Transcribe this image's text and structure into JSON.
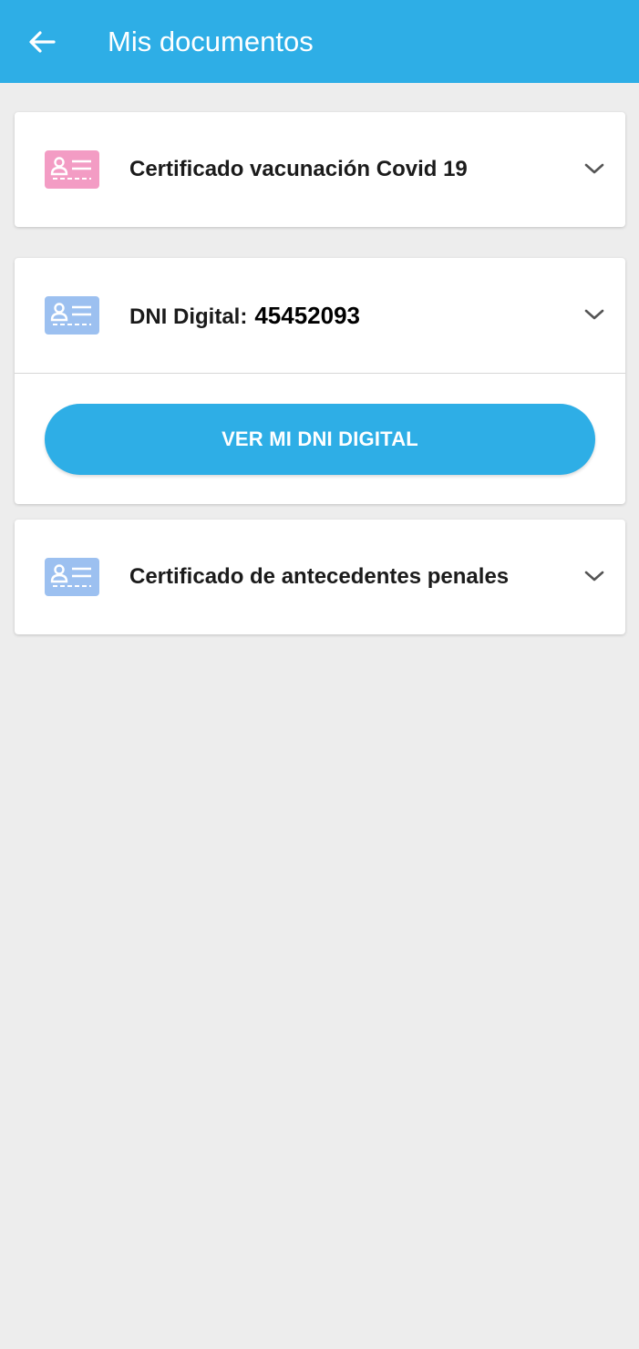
{
  "appbar": {
    "title": "Mis documentos",
    "back_icon": "arrow-left-icon",
    "color": "#2eaee6"
  },
  "documents": [
    {
      "label": "Certificado vacunación Covid 19",
      "icon": "id-card-icon",
      "icon_color": "#f39cc4",
      "expanded": false
    },
    {
      "label": "DNI Digital:",
      "number": "45452093",
      "icon": "id-card-icon",
      "icon_color": "#9cc0f0",
      "expanded": true,
      "action_label": "VER MI DNI DIGITAL"
    },
    {
      "label": "Certificado de antecedentes penales",
      "icon": "id-card-icon",
      "icon_color": "#9cc0f0",
      "expanded": false
    }
  ],
  "chevron_icon": "chevron-down-icon"
}
